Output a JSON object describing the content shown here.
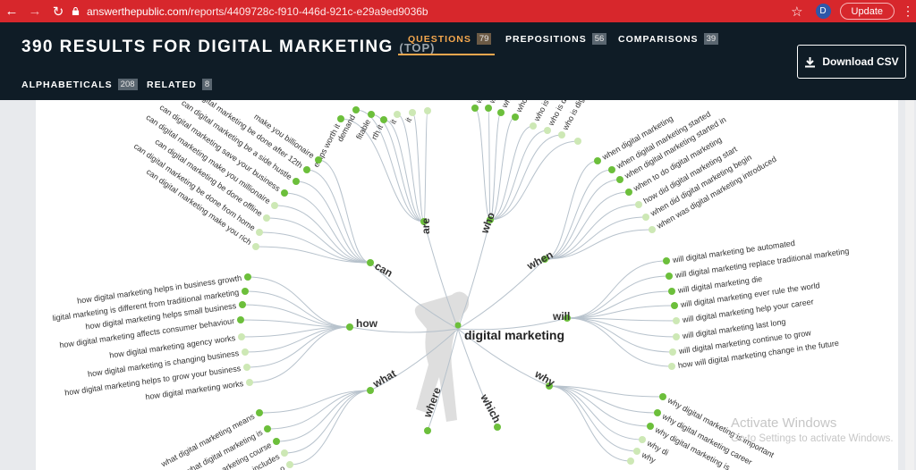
{
  "browser": {
    "url_host": "answerthepublic.com",
    "url_path": "/reports/4409728c-f910-446d-921c-e29a9ed9036b",
    "profile_initial": "D",
    "update_label": "Update"
  },
  "header": {
    "title": "390 RESULTS FOR DIGITAL MARKETING",
    "title_suffix": "(TOP)",
    "tabs": [
      {
        "label": "QUESTIONS",
        "count": "79"
      },
      {
        "label": "PREPOSITIONS",
        "count": "56"
      },
      {
        "label": "COMPARISONS",
        "count": "39"
      },
      {
        "label": "ALPHABETICALS",
        "count": "208"
      },
      {
        "label": "RELATED",
        "count": "8"
      }
    ],
    "download_label": "Download CSV"
  },
  "wheel": {
    "center_label": "digital marketing",
    "branches": [
      {
        "label": "are",
        "leaves": [
          "emps worth it",
          "demand",
          "fitable",
          "rth it",
          "it",
          "it"
        ]
      },
      {
        "label": "who",
        "leaves": [
          "w",
          "w",
          "wh",
          "who",
          "who is",
          "who is dig",
          "who is digital"
        ]
      },
      {
        "label": "when",
        "leaves": [
          "when digital marketing",
          "when digital marketing started",
          "when digital marketing started in",
          "when to do digital marketing",
          "how did digital marketing start",
          "when did digital marketing begin",
          "when was digital marketing introduced"
        ]
      },
      {
        "label": "will",
        "leaves": [
          "will digital marketing be automated",
          "will digital marketing replace traditional marketing",
          "will digital marketing die",
          "will digital marketing ever rule the world",
          "will digital marketing help your career",
          "will digital marketing last long",
          "will digital marketing continue to grow",
          "how will digital marketing change in the future"
        ]
      },
      {
        "label": "why",
        "leaves": [
          "why digital marketing is important",
          "why digital marketing career",
          "why digital marketing is",
          "why di",
          "why"
        ]
      },
      {
        "label": "which",
        "leaves": []
      },
      {
        "label": "where",
        "leaves": []
      },
      {
        "label": "what",
        "leaves": [
          "what digital marketing means",
          "what digital marketing is",
          "arketing course",
          "includes",
          "o"
        ]
      },
      {
        "label": "how",
        "leaves": [
          "how digital marketing helps in business growth",
          "ligital marketing is different from traditional marketing",
          "how digital marketing helps small business",
          "how digital marketing affects consumer behaviour",
          "how digital marketing agency works",
          "how digital marketing is changing business",
          "how digital marketing helps to grow your business",
          "how digital marketing works"
        ]
      },
      {
        "label": "can",
        "leaves": [
          "make you billionaire",
          "digital marketing be done after 12th",
          "can digital marketing be a side hustle",
          "can digital marketing save your business",
          "can digital marketing make you millionaire",
          "can digital marketing be done offline",
          "can digital marketing be done from home",
          "can digital marketing make you rich"
        ]
      }
    ]
  },
  "watermark": {
    "title": "Activate Windows",
    "subtitle": "Go to Settings to activate Windows."
  },
  "colors": {
    "chrome_red": "#d7272c",
    "header_bg": "#0f1c26",
    "accent_orange": "#f4a74e",
    "node_green": "#6cbf3b",
    "node_light": "#cde8b5",
    "link_gray": "#b7c2cc"
  }
}
